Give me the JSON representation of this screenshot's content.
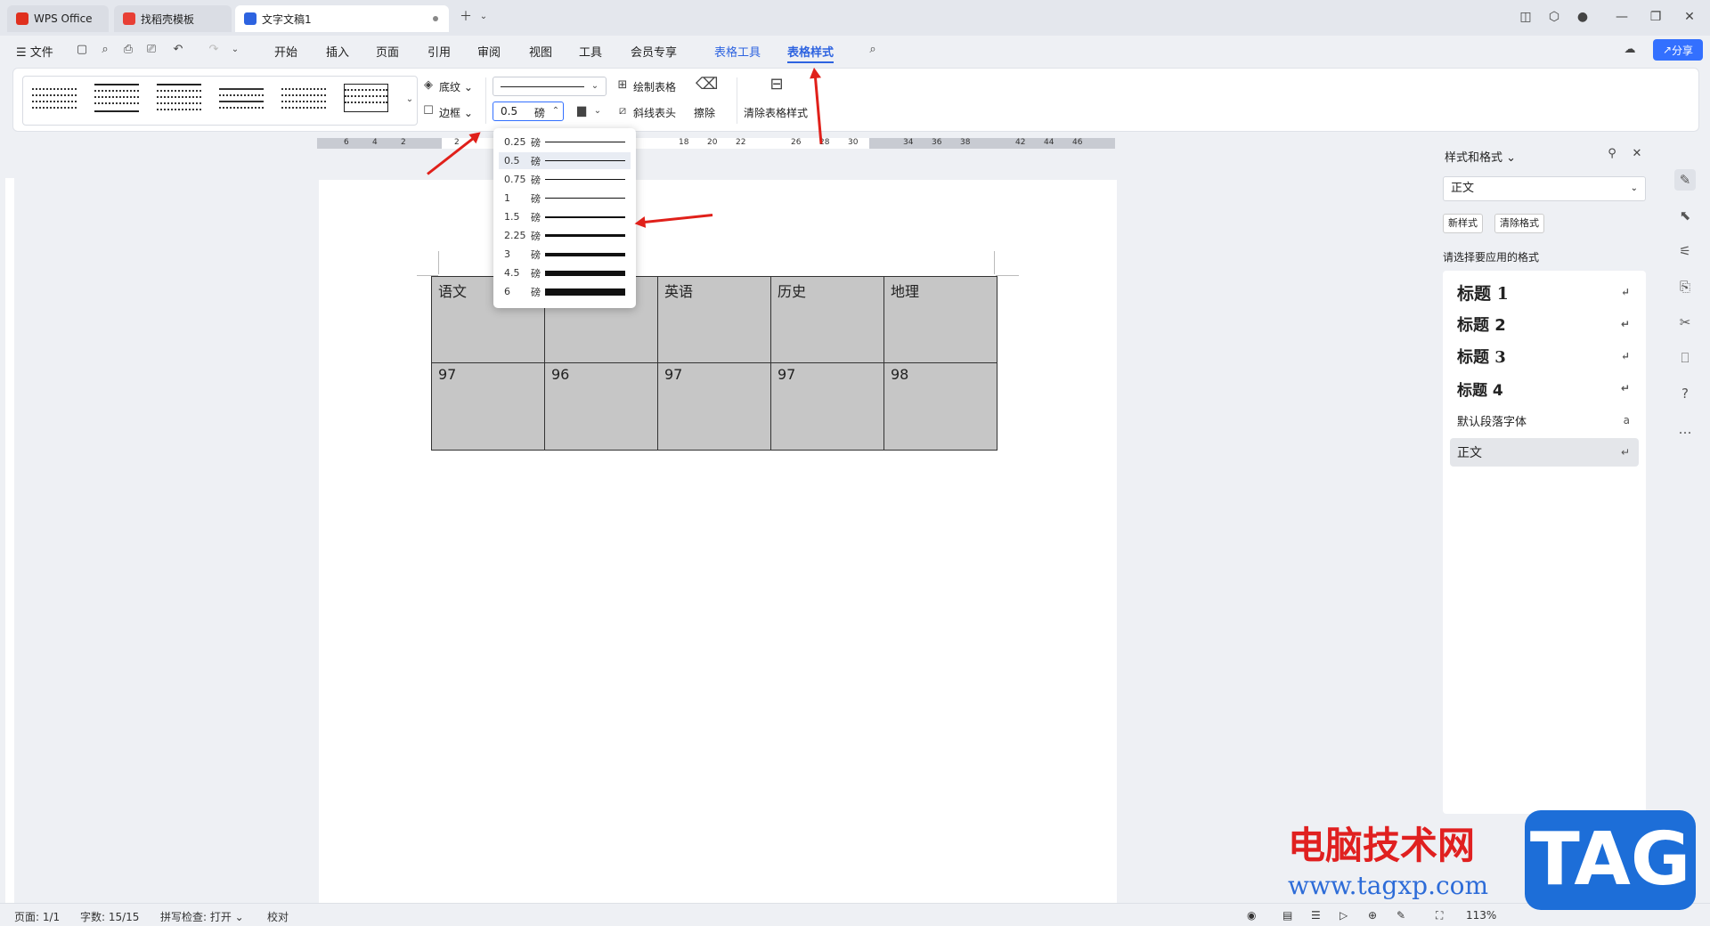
{
  "tabs": [
    {
      "label": "WPS Office",
      "icon": "wps-logo-icon"
    },
    {
      "label": "找稻壳模板",
      "icon": "docer-icon"
    },
    {
      "label": "文字文稿1",
      "icon": "word-doc-icon"
    }
  ],
  "menu": {
    "file": "文件",
    "items": [
      "开始",
      "插入",
      "页面",
      "引用",
      "审阅",
      "视图",
      "工具",
      "会员专享"
    ],
    "table_tools": "表格工具",
    "table_style": "表格样式",
    "share": "分享"
  },
  "ribbon": {
    "shading": "底纹",
    "border": "边框",
    "line_width_value": "0.5",
    "line_width_unit": "磅",
    "draw_table": "绘制表格",
    "diagonal_header": "斜线表头",
    "erase": "擦除",
    "clear_table_style": "清除表格样式"
  },
  "line_width_options": [
    {
      "value": "0.25",
      "unit": "磅"
    },
    {
      "value": "0.5",
      "unit": "磅",
      "selected": true
    },
    {
      "value": "0.75",
      "unit": "磅"
    },
    {
      "value": "1",
      "unit": "磅"
    },
    {
      "value": "1.5",
      "unit": "磅"
    },
    {
      "value": "2.25",
      "unit": "磅"
    },
    {
      "value": "3",
      "unit": "磅"
    },
    {
      "value": "4.5",
      "unit": "磅"
    },
    {
      "value": "6",
      "unit": "磅"
    }
  ],
  "ruler_numbers_h": [
    "6",
    "4",
    "2",
    "2",
    "18",
    "20",
    "22",
    "26",
    "28",
    "30",
    "34",
    "36",
    "38",
    "42",
    "44",
    "46"
  ],
  "table": {
    "header": [
      "语文",
      "",
      "英语",
      "历史",
      "地理"
    ],
    "row": [
      "97",
      "96",
      "97",
      "97",
      "98"
    ]
  },
  "right_pane": {
    "title": "样式和格式",
    "current_style": "正文",
    "new_style": "新样式",
    "clear_format": "清除格式",
    "prompt": "请选择要应用的格式",
    "styles": [
      "标题 1",
      "标题 2",
      "标题 3",
      "标题 4",
      "默认段落字体",
      "正文"
    ]
  },
  "status": {
    "page": "页面: 1/1",
    "words": "字数: 15/15",
    "spell": "拼写检查: 打开",
    "proof": "校对",
    "zoom": "113%"
  },
  "watermark": {
    "text": "电脑技术网",
    "url": "www.tagxp.com",
    "logo": "TAG"
  },
  "colors": {
    "accent": "#2d63e0",
    "share": "#3370ff",
    "arrow": "#e0201a",
    "cell_fill": "#c6c6c6"
  }
}
